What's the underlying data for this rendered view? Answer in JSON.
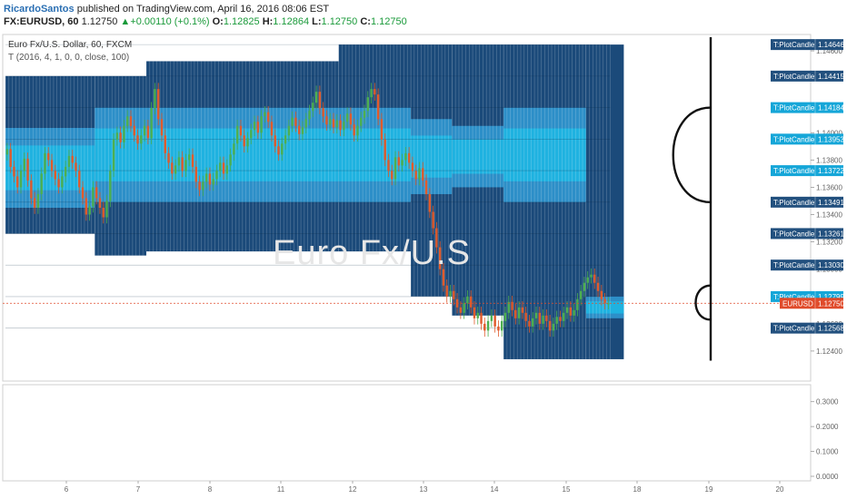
{
  "header": {
    "author": "RicardoSantos",
    "published_text": "published on TradingView.com, April 16, 2016 08:06 EST",
    "symbol": "FX:EURUSD, 60",
    "last": "1.12750",
    "change_arrow": "▲",
    "change": "+0.00110 (+0.1%)",
    "o_label": "O:",
    "o_value": "1.12825",
    "h_label": "H:",
    "h_value": "1.12864",
    "l_label": "L:",
    "l_value": "1.12750",
    "c_label": "C:",
    "c_value": "1.12750"
  },
  "legend": {
    "instrument": "Euro Fx/U.S. Dollar, 60, FXCM",
    "indicator": "T (2016, 4, 1, 0, 0, close, 100)"
  },
  "watermark": "Euro Fx/U.S",
  "colors": {
    "dark_band": "#1b4a7a",
    "light_band": "#1fb2e0",
    "mid_band": "#2d8fc8",
    "candle_up": "#4caf50",
    "candle_down": "#e05a2b",
    "last_price": "#e04b2b"
  },
  "chart_data": {
    "type": "candlestick",
    "ylim": [
      1.1218,
      1.1472
    ],
    "x_tick_labels": [
      "6",
      "7",
      "8",
      "11",
      "12",
      "13",
      "14",
      "15",
      "18",
      "19",
      "20"
    ],
    "y_tick_labels": [
      "1.14800",
      "1.14600",
      "1.14400",
      "1.14200",
      "1.14000",
      "1.13800",
      "1.13600",
      "1.13400",
      "1.13200",
      "1.13000",
      "1.12800",
      "1.12600",
      "1.12400"
    ],
    "y_ticks": [
      1.148,
      1.146,
      1.144,
      1.142,
      1.14,
      1.138,
      1.136,
      1.134,
      1.132,
      1.13,
      1.128,
      1.126,
      1.124
    ],
    "price_labels": [
      {
        "name": "T:PlotCandle",
        "value": "1.14646",
        "v": 1.14646,
        "kind": "dark"
      },
      {
        "name": "T:PlotCandle",
        "value": "1.14415",
        "v": 1.14415,
        "kind": "dark"
      },
      {
        "name": "T:PlotCandle",
        "value": "1.14184",
        "v": 1.14184,
        "kind": "light"
      },
      {
        "name": "T:PlotCandle",
        "value": "1.13953",
        "v": 1.13953,
        "kind": "light"
      },
      {
        "name": "T:PlotCandle",
        "value": "1.13722",
        "v": 1.13722,
        "kind": "light"
      },
      {
        "name": "T:PlotCandle",
        "value": "1.13491",
        "v": 1.13491,
        "kind": "dark"
      },
      {
        "name": "T:PlotCandle",
        "value": "1.13261",
        "v": 1.13261,
        "kind": "dark"
      },
      {
        "name": "T:PlotCandle",
        "value": "1.13030",
        "v": 1.1303,
        "kind": "dark"
      },
      {
        "name": "T:PlotCandle",
        "value": "1.12799",
        "v": 1.12799,
        "kind": "light"
      },
      {
        "name": "EURUSD",
        "value": "1.12750",
        "v": 1.1275,
        "kind": "last"
      },
      {
        "name": "T:PlotCandle",
        "value": "1.12568",
        "v": 1.12568,
        "kind": "dark"
      }
    ],
    "last_price": 1.1275,
    "lower_pane": {
      "y_tick_labels": [
        "0.3000",
        "0.2000",
        "0.1000",
        "0.0000"
      ],
      "ylim": [
        0,
        0.35
      ]
    },
    "profile_segments": [
      {
        "bars_from": 0,
        "bars_to": 26,
        "top": 1.14415,
        "bottom": 1.1326,
        "light_top": 1.14035,
        "light_bottom": 1.1345
      },
      {
        "bars_from": 26,
        "bars_to": 41,
        "top": 1.14415,
        "bottom": 1.131,
        "light_top": 1.14184,
        "light_bottom": 1.13491
      },
      {
        "bars_from": 41,
        "bars_to": 97,
        "top": 1.14524,
        "bottom": 1.1313,
        "light_top": 1.14184,
        "light_bottom": 1.13491
      },
      {
        "bars_from": 97,
        "bars_to": 118,
        "top": 1.14646,
        "bottom": 1.1313,
        "light_top": 1.14184,
        "light_bottom": 1.13491
      },
      {
        "bars_from": 118,
        "bars_to": 130,
        "top": 1.14646,
        "bottom": 1.128,
        "light_top": 1.141,
        "light_bottom": 1.1355
      },
      {
        "bars_from": 130,
        "bars_to": 145,
        "top": 1.14646,
        "bottom": 1.1266,
        "light_top": 1.1405,
        "light_bottom": 1.136
      },
      {
        "bars_from": 145,
        "bars_to": 169,
        "top": 1.14646,
        "bottom": 1.1234,
        "light_top": 1.14184,
        "light_bottom": 1.13491
      },
      {
        "bars_from": 169,
        "bars_to": 180,
        "top": 1.14646,
        "bottom": 1.1234,
        "light_top": 1.12799,
        "light_bottom": 1.1264
      }
    ],
    "close": [
      1.1388,
      1.1375,
      1.1368,
      1.136,
      1.1372,
      1.1381,
      1.1365,
      1.1352,
      1.1345,
      1.1355,
      1.137,
      1.1385,
      1.138,
      1.1372,
      1.1366,
      1.136,
      1.1368,
      1.1375,
      1.1383,
      1.1378,
      1.1372,
      1.136,
      1.1352,
      1.134,
      1.1346,
      1.136,
      1.1352,
      1.1345,
      1.1338,
      1.135,
      1.1372,
      1.1395,
      1.14,
      1.1393,
      1.1405,
      1.1412,
      1.1405,
      1.1398,
      1.1392,
      1.1398,
      1.1405,
      1.1396,
      1.1418,
      1.1432,
      1.141,
      1.1398,
      1.1385,
      1.1378,
      1.137,
      1.1376,
      1.1382,
      1.1372,
      1.138,
      1.1384,
      1.1375,
      1.1364,
      1.1358,
      1.1364,
      1.137,
      1.1362,
      1.1366,
      1.1372,
      1.1378,
      1.137,
      1.1376,
      1.1384,
      1.1392,
      1.1405,
      1.1398,
      1.139,
      1.1396,
      1.1402,
      1.1408,
      1.14,
      1.1412,
      1.1415,
      1.1408,
      1.1398,
      1.139,
      1.1384,
      1.1392,
      1.1398,
      1.1405,
      1.1411,
      1.1405,
      1.1399,
      1.1404,
      1.141,
      1.1416,
      1.1422,
      1.143,
      1.1418,
      1.1412,
      1.1406,
      1.141,
      1.1404,
      1.1409,
      1.1402,
      1.1408,
      1.1414,
      1.1406,
      1.1398,
      1.1405,
      1.1411,
      1.1416,
      1.1426,
      1.1432,
      1.1428,
      1.141,
      1.1395,
      1.138,
      1.1372,
      1.1366,
      1.1382,
      1.1376,
      1.138,
      1.1385,
      1.1378,
      1.1372,
      1.1366,
      1.1374,
      1.1365,
      1.1355,
      1.1342,
      1.133,
      1.1316,
      1.13,
      1.1288,
      1.128,
      1.1284,
      1.1278,
      1.1272,
      1.1268,
      1.1275,
      1.128,
      1.1272,
      1.1264,
      1.1268,
      1.126,
      1.1255,
      1.1262,
      1.1266,
      1.1258,
      1.1255,
      1.1262,
      1.1268,
      1.1276,
      1.127,
      1.1264,
      1.1272,
      1.1268,
      1.1262,
      1.1258,
      1.1264,
      1.1268,
      1.126,
      1.1266,
      1.1262,
      1.1255,
      1.126,
      1.1265,
      1.1262,
      1.1268,
      1.1272,
      1.1266,
      1.127,
      1.1278,
      1.1284,
      1.129,
      1.1294,
      1.1296,
      1.129,
      1.1284,
      1.1278,
      1.1275,
      1.1275
    ]
  }
}
